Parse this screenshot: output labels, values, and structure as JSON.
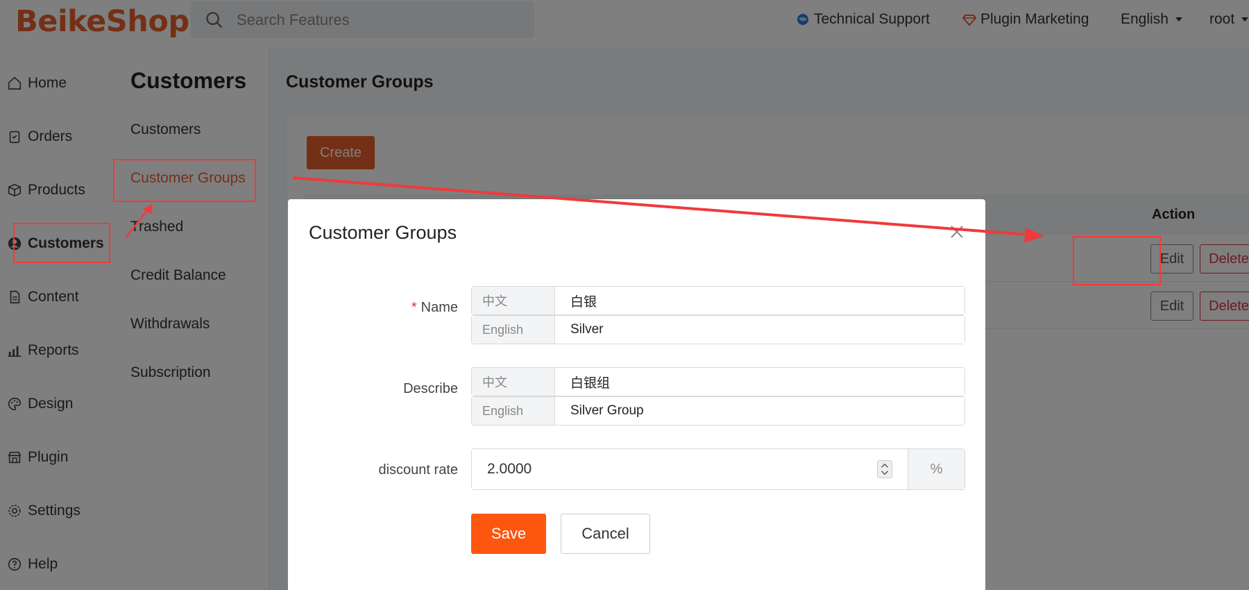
{
  "header": {
    "logo": "BeikeShop",
    "search_placeholder": "Search Features",
    "technical_support": "Technical Support",
    "plugin_marketing": "Plugin Marketing",
    "language": "English",
    "user": "root"
  },
  "sidebar": {
    "items": [
      {
        "label": "Home",
        "icon": "home-icon"
      },
      {
        "label": "Orders",
        "icon": "clipboard-icon"
      },
      {
        "label": "Products",
        "icon": "box-icon"
      },
      {
        "label": "Customers",
        "icon": "user-circle-icon"
      },
      {
        "label": "Content",
        "icon": "document-icon"
      },
      {
        "label": "Reports",
        "icon": "bar-chart-icon"
      },
      {
        "label": "Design",
        "icon": "palette-icon"
      },
      {
        "label": "Plugin",
        "icon": "shop-icon"
      },
      {
        "label": "Settings",
        "icon": "gear-icon"
      },
      {
        "label": "Help",
        "icon": "question-icon"
      }
    ],
    "active": "Customers"
  },
  "subnav": {
    "title": "Customers",
    "items": [
      "Customers",
      "Customer Groups",
      "Trashed",
      "Credit Balance",
      "Withdrawals",
      "Subscription"
    ],
    "active": "Customer Groups"
  },
  "main": {
    "title": "Customer Groups",
    "create_label": "Create",
    "table": {
      "action_header": "Action",
      "rows": [
        {
          "edit": "Edit",
          "delete": "Delete"
        },
        {
          "edit": "Edit",
          "delete": "Delete"
        }
      ]
    }
  },
  "modal": {
    "title": "Customer Groups",
    "name_label": "Name",
    "required_mark": "*",
    "describe_label": "Describe",
    "discount_label": "discount rate",
    "name": [
      {
        "lang": "中文",
        "value": "白银"
      },
      {
        "lang": "English",
        "value": "Silver"
      }
    ],
    "describe": [
      {
        "lang": "中文",
        "value": "白银组"
      },
      {
        "lang": "English",
        "value": "Silver Group"
      }
    ],
    "discount_rate": "2.0000",
    "discount_suffix": "%",
    "save_label": "Save",
    "cancel_label": "Cancel"
  },
  "colors": {
    "brand": "#e8612c",
    "save": "#fd560f",
    "delete": "#dc3545",
    "annotation": "#f03a3a"
  }
}
